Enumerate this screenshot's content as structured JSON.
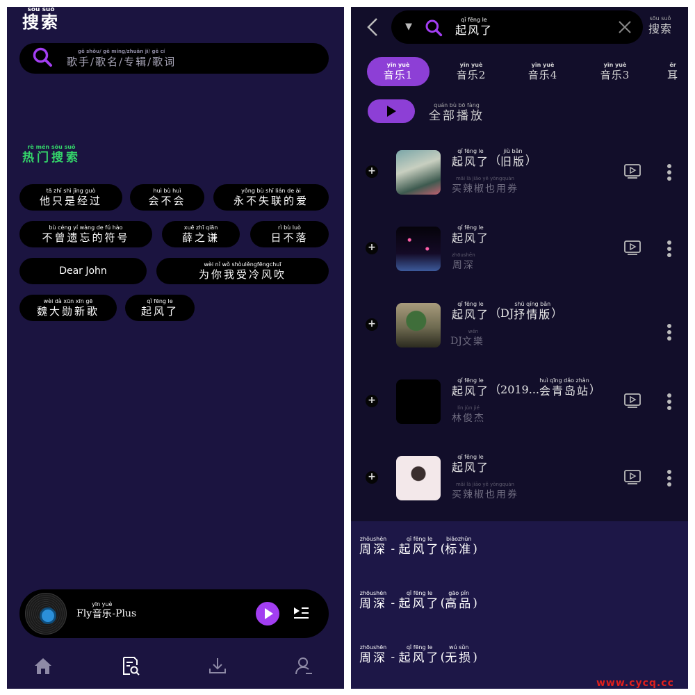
{
  "left": {
    "title": {
      "hz": "搜索",
      "py": "sōu suǒ"
    },
    "search_placeholder": {
      "hz": "歌手/歌名/专辑/歌词",
      "py": "gē shǒu/ gē míng/zhuān jí/ gē cí"
    },
    "hot_title": {
      "hz": "热门搜索",
      "py": "rè mén sōu suǒ"
    },
    "hot_tags": [
      {
        "hz": "他只是经过",
        "py": "tā zhǐ shì jīng guò"
      },
      {
        "hz": "会不会",
        "py": "huì bù huì"
      },
      {
        "hz": "永不失联的爱",
        "py": "yǒng bù shī lián de ài"
      },
      {
        "hz": "不曾遗忘的符号",
        "py": "bù céng yí wàng de fú hào"
      },
      {
        "hz": "薛之谦",
        "py": "xuē zhī qiān"
      },
      {
        "hz": "日不落",
        "py": "rì bù luò"
      },
      {
        "text": "Dear John"
      },
      {
        "hz": "为你我受冷风吹",
        "py": "wèi nǐ wǒ shòulěngfēngchuī"
      },
      {
        "hz": "魏大勋新歌",
        "py": "wèi dà xūn xīn gē"
      },
      {
        "hz": "起风了",
        "py": "qǐ fēng le"
      }
    ],
    "player": {
      "prefix": "Fly",
      "hz": "音乐",
      "py": "yīn yuè",
      "suffix": "-Plus"
    }
  },
  "right": {
    "query": {
      "hz": "起风了",
      "py": "qǐ fēng le"
    },
    "search_button": {
      "hz": "搜索",
      "py": "sōu suǒ"
    },
    "tabs": [
      {
        "hz": "音乐",
        "py": "yīn yuè",
        "num": "1"
      },
      {
        "hz": "音乐",
        "py": "yīn yuè",
        "num": "2"
      },
      {
        "hz": "音乐",
        "py": "yīn yuè",
        "num": "4"
      },
      {
        "hz": "音乐",
        "py": "yīn yuè",
        "num": "3"
      },
      {
        "hz": "耳",
        "py": "ěr",
        "num": ""
      }
    ],
    "play_all": {
      "hz": "全部播放",
      "py": "quán bù bō fàng"
    },
    "songs": [
      {
        "title_hz": "起风了",
        "title_py": "qǐ fēng le",
        "ver_hz": "旧版",
        "ver_py": "jiù bǎn",
        "ver_pre": "（",
        "ver_post": "）",
        "artist_hz": "买辣椒也用券",
        "artist_py": "mǎi là jiāo yě yòngquàn",
        "artist_pre": ""
      },
      {
        "title_hz": "起风了",
        "title_py": "qǐ fēng le",
        "ver_hz": "",
        "ver_py": "",
        "ver_pre": "",
        "ver_post": "",
        "artist_hz": "周深",
        "artist_py": "zhōushēn",
        "artist_pre": ""
      },
      {
        "title_hz": "起风了",
        "title_py": "qǐ fēng le",
        "ver_hz": "抒情版",
        "ver_py": "shū qíng bǎn",
        "ver_pre": "（DJ",
        "ver_post": "）",
        "artist_hz": "文樂",
        "artist_py": "wén",
        "artist_pre": "DJ"
      },
      {
        "title_hz": "起风了",
        "title_py": "qǐ fēng le",
        "ver_hz": "会青岛站",
        "ver_py": "huì qīng dǎo zhàn",
        "ver_pre": "（2019...",
        "ver_post": "）",
        "artist_hz": "林俊杰",
        "artist_py": "lín jùn jié",
        "artist_pre": ""
      },
      {
        "title_hz": "起风了",
        "title_py": "qǐ fēng le",
        "ver_hz": "",
        "ver_py": "",
        "ver_pre": "",
        "ver_post": "",
        "artist_hz": "买辣椒也用券",
        "artist_py": "mǎi là jiāo yě yòngquàn",
        "artist_pre": ""
      }
    ],
    "quality_options": [
      {
        "artist_hz": "周深",
        "artist_py": "zhōushēn",
        "dash": " - ",
        "title_hz": "起风了",
        "title_py": "qǐ fēng le",
        "q_hz": "标准",
        "q_py": "biāozhǔn"
      },
      {
        "artist_hz": "周深",
        "artist_py": "zhōushēn",
        "dash": " - ",
        "title_hz": "起风了",
        "title_py": "qǐ fēng le",
        "q_hz": "高品",
        "q_py": "gāo pǐn"
      },
      {
        "artist_hz": "周深",
        "artist_py": "zhōushēn",
        "dash": " - ",
        "title_hz": "起风了",
        "title_py": "qǐ fēng le",
        "q_hz": "无损",
        "q_py": "wú sǔn"
      }
    ]
  },
  "watermark": "www.cycq.cc",
  "colors": {
    "accent": "#a23ef1",
    "tab_accent": "#8d3fd6",
    "hot": "#34d56a",
    "left_bg": "#1b1440",
    "right_bg": "#120e2a",
    "sheet_bg": "#1d1747"
  },
  "icons": [
    "search-icon",
    "home-icon",
    "search-history-icon",
    "download-icon",
    "user-icon",
    "back-icon",
    "clear-icon",
    "dropdown-icon",
    "add-icon",
    "mv-icon",
    "more-icon",
    "queue-icon",
    "play-icon"
  ]
}
